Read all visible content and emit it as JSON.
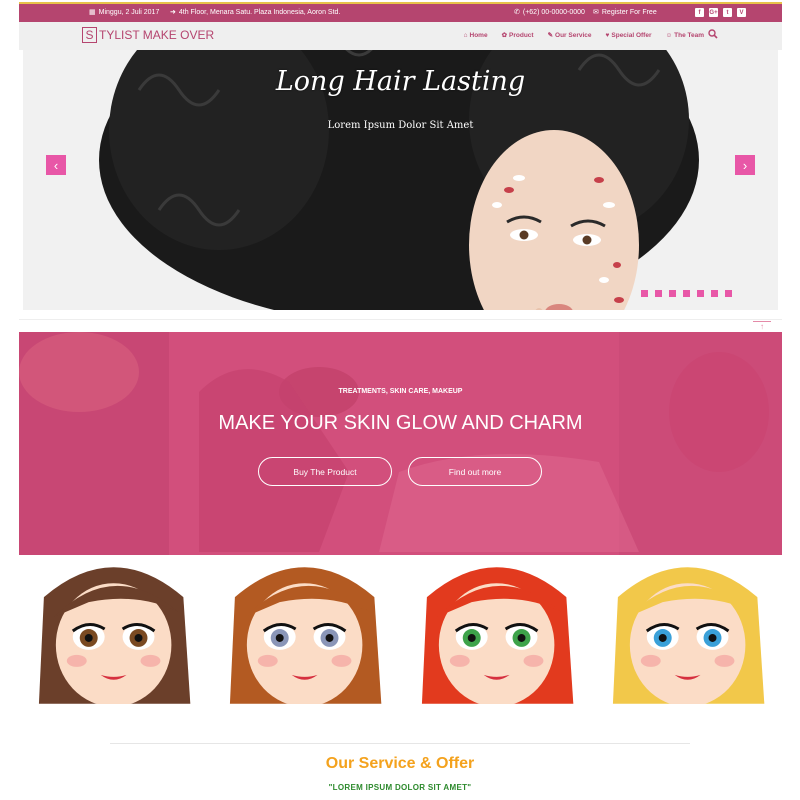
{
  "topbar": {
    "date": "Minggu, 2 Juli 2017",
    "address": "4th Floor, Menara Satu. Plaza Indonesia, Aoron Std.",
    "phone": "(+62) 00-0000-0000",
    "register": "Register For Free",
    "social": [
      "f",
      "G+",
      "t",
      "V"
    ]
  },
  "nav": {
    "logo_letter": "S",
    "logo_text": "TYLIST MAKE OVER",
    "items": [
      "Home",
      "Product",
      "Our Service",
      "Special Offer",
      "The Team"
    ]
  },
  "slider": {
    "title": "Long Hair Lasting",
    "subtitle": "Lorem Ipsum Dolor Sit Amet",
    "prev": "‹",
    "next": "›",
    "slide_count": 7
  },
  "back_to_top": "↑",
  "hero": {
    "tagline": "TREATMENTS, SKIN CARE, MAKEUP",
    "title": "MAKE YOUR SKIN GLOW AND CHARM",
    "btn_primary": "Buy The Product",
    "btn_secondary": "Find out more"
  },
  "faces": [
    {
      "hair": "#6b3f2a",
      "eyes": "#7a4a22"
    },
    {
      "hair": "#b35a22",
      "eyes": "#8a96b8"
    },
    {
      "hair": "#e23a1e",
      "eyes": "#3ea34a"
    },
    {
      "hair": "#f2c84a",
      "eyes": "#3aa0d8"
    }
  ],
  "section": {
    "title": "Our Service & Offer",
    "subtitle": "\"LOREM IPSUM DOLOR SIT AMET\""
  },
  "colors": {
    "brand": "#b5456f",
    "accent_pink": "#e857a7",
    "hero_bg": "#d24f7c",
    "section_title": "#f4a21d",
    "section_subtitle": "#2d8a2d"
  }
}
